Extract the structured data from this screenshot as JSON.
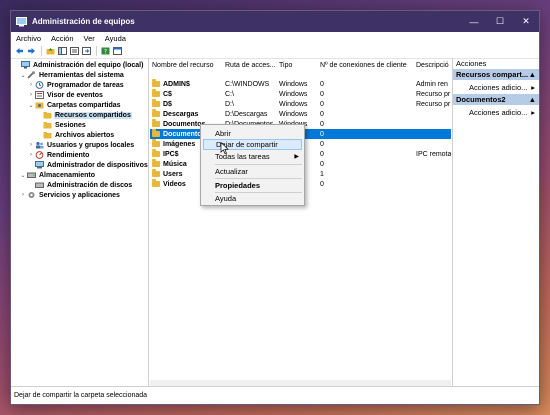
{
  "window": {
    "title": "Administración de equipos"
  },
  "menubar": [
    "Archivo",
    "Acción",
    "Ver",
    "Ayuda"
  ],
  "tree": [
    {
      "label": "Administración del equipo (local)",
      "level": 0,
      "twisty": "",
      "icon": "computer-icon",
      "selected": false
    },
    {
      "label": "Herramientas del sistema",
      "level": 1,
      "twisty": "v",
      "icon": "tools-icon",
      "selected": false
    },
    {
      "label": "Programador de tareas",
      "level": 2,
      "twisty": ">",
      "icon": "clock-icon",
      "selected": false
    },
    {
      "label": "Visor de eventos",
      "level": 2,
      "twisty": ">",
      "icon": "event-icon",
      "selected": false
    },
    {
      "label": "Carpetas compartidas",
      "level": 2,
      "twisty": "v",
      "icon": "shared-folder-icon",
      "selected": false
    },
    {
      "label": "Recursos compartidos",
      "level": 3,
      "twisty": "",
      "icon": "folder-icon",
      "selected": true
    },
    {
      "label": "Sesiones",
      "level": 3,
      "twisty": "",
      "icon": "folder-icon",
      "selected": false
    },
    {
      "label": "Archivos abiertos",
      "level": 3,
      "twisty": "",
      "icon": "folder-icon",
      "selected": false
    },
    {
      "label": "Usuarios y grupos locales",
      "level": 2,
      "twisty": ">",
      "icon": "users-icon",
      "selected": false
    },
    {
      "label": "Rendimiento",
      "level": 2,
      "twisty": ">",
      "icon": "performance-icon",
      "selected": false
    },
    {
      "label": "Administrador de dispositivos",
      "level": 2,
      "twisty": "",
      "icon": "device-icon",
      "selected": false
    },
    {
      "label": "Almacenamiento",
      "level": 1,
      "twisty": "v",
      "icon": "storage-icon",
      "selected": false
    },
    {
      "label": "Administración de discos",
      "level": 2,
      "twisty": "",
      "icon": "disk-icon",
      "selected": false
    },
    {
      "label": "Servicios y aplicaciones",
      "level": 1,
      "twisty": ">",
      "icon": "services-icon",
      "selected": false
    }
  ],
  "columns": [
    "Nombre del recurso",
    "Ruta de acces...",
    "Tipo",
    "Nº de conexiones de cliente",
    "Descripció"
  ],
  "rows": [
    {
      "name": "ADMIN$",
      "path": "C:\\WINDOWS",
      "type": "Windows",
      "conn": "0",
      "desc": "Admin ren",
      "selected": false
    },
    {
      "name": "C$",
      "path": "C:\\",
      "type": "Windows",
      "conn": "0",
      "desc": "Recurso pr",
      "selected": false
    },
    {
      "name": "D$",
      "path": "D:\\",
      "type": "Windows",
      "conn": "0",
      "desc": "Recurso pr",
      "selected": false
    },
    {
      "name": "Descargas",
      "path": "D:\\Descargas",
      "type": "Windows",
      "conn": "0",
      "desc": "",
      "selected": false
    },
    {
      "name": "Documentos",
      "path": "D:\\Documentos",
      "type": "Windows",
      "conn": "0",
      "desc": "",
      "selected": false
    },
    {
      "name": "Documentos2",
      "path": "",
      "type": "",
      "conn": "0",
      "desc": "",
      "selected": true
    },
    {
      "name": "Imágenes",
      "path": "",
      "type": "",
      "conn": "0",
      "desc": "",
      "selected": false
    },
    {
      "name": "IPC$",
      "path": "",
      "type": "",
      "conn": "0",
      "desc": "IPC remota",
      "selected": false
    },
    {
      "name": "Música",
      "path": "",
      "type": "",
      "conn": "0",
      "desc": "",
      "selected": false
    },
    {
      "name": "Users",
      "path": "",
      "type": "",
      "conn": "1",
      "desc": "",
      "selected": false
    },
    {
      "name": "Videos",
      "path": "",
      "type": "",
      "conn": "0",
      "desc": "",
      "selected": false
    }
  ],
  "context_menu": {
    "abrir": "Abrir",
    "dejar": "Dejar de compartir",
    "todas": "Todas las tareas",
    "actualizar": "Actualizar",
    "propiedades": "Propiedades",
    "ayuda": "Ayuda"
  },
  "actions": {
    "title": "Acciones",
    "section1": "Recursos compart...",
    "item1": "Acciones adicio...",
    "section2": "Documentos2",
    "item2": "Acciones adicio..."
  },
  "status": "Dejar de compartir la carpeta seleccionada",
  "colors": {
    "titlebar": "#3d3166",
    "selection": "#0078d7",
    "action_header": "#b6cbe5"
  }
}
